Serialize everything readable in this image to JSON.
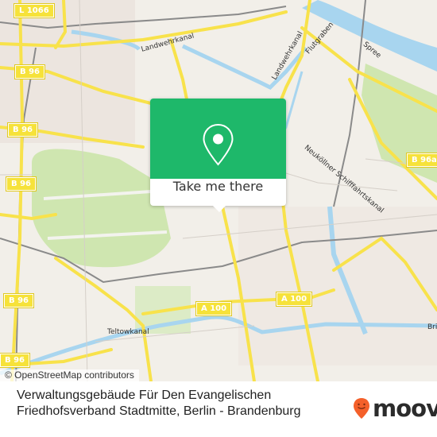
{
  "map": {
    "attribution": "© OpenStreetMap contributors",
    "colors": {
      "land": "#f2efe9",
      "park": "#cde7ad",
      "water": "#a8d5ef",
      "major_road": "#f8e24b",
      "rail": "#8a8a8a",
      "accent_green": "#1eb86a",
      "moovit_orange": "#f4602a"
    },
    "road_shields": [
      {
        "label": "L 1066"
      },
      {
        "label": "B 96"
      },
      {
        "label": "B 96"
      },
      {
        "label": "B 96"
      },
      {
        "label": "B 96"
      },
      {
        "label": "B 96"
      },
      {
        "label": "B 96a"
      },
      {
        "label": "A 100"
      },
      {
        "label": "A 100"
      }
    ],
    "place_labels": [
      {
        "label": "Landwehrkanal"
      },
      {
        "label": "Landwehrkanal"
      },
      {
        "label": "Flutgraben"
      },
      {
        "label": "Spree"
      },
      {
        "label": "Neuköllner Schifffahrtskanal"
      },
      {
        "label": "Teltowkanal"
      },
      {
        "label": "Brit"
      }
    ]
  },
  "popup": {
    "icon": "location-pin-icon",
    "button_label": "Take me there"
  },
  "footer": {
    "place_name": "Verwaltungsgebäude Für Den Evangelischen Friedhofsverband Stadtmitte, Berlin - Brandenburg",
    "brand": "moovit",
    "brand_icon": "moovit-smiley-pin-icon"
  }
}
